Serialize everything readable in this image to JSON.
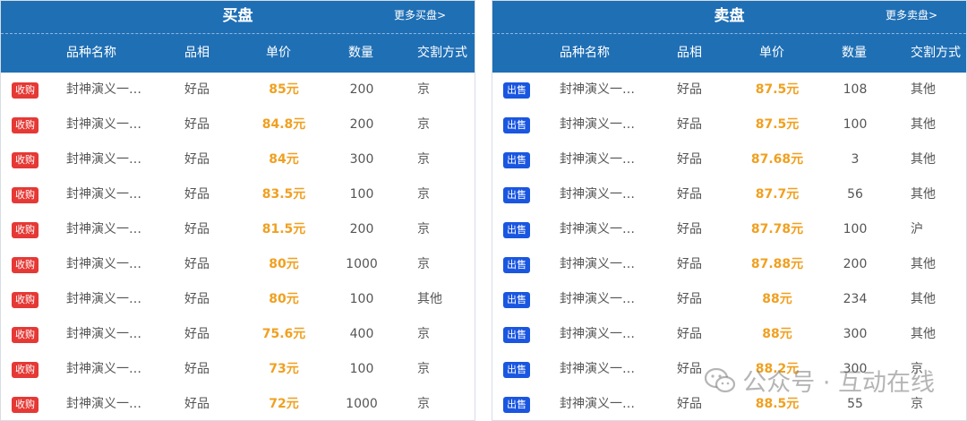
{
  "buy": {
    "title": "买盘",
    "more_label": "更多买盘>",
    "columns": [
      "品种名称",
      "品相",
      "单价",
      "数量",
      "交割方式"
    ],
    "badge_label": "收购",
    "rows": [
      {
        "name": "封神演义一…",
        "grade": "好品",
        "price": "85元",
        "qty": "200",
        "delivery": "京"
      },
      {
        "name": "封神演义一…",
        "grade": "好品",
        "price": "84.8元",
        "qty": "200",
        "delivery": "京"
      },
      {
        "name": "封神演义一…",
        "grade": "好品",
        "price": "84元",
        "qty": "300",
        "delivery": "京"
      },
      {
        "name": "封神演义一…",
        "grade": "好品",
        "price": "83.5元",
        "qty": "100",
        "delivery": "京"
      },
      {
        "name": "封神演义一…",
        "grade": "好品",
        "price": "81.5元",
        "qty": "200",
        "delivery": "京"
      },
      {
        "name": "封神演义一…",
        "grade": "好品",
        "price": "80元",
        "qty": "1000",
        "delivery": "京"
      },
      {
        "name": "封神演义一…",
        "grade": "好品",
        "price": "80元",
        "qty": "100",
        "delivery": "其他"
      },
      {
        "name": "封神演义一…",
        "grade": "好品",
        "price": "75.6元",
        "qty": "400",
        "delivery": "京"
      },
      {
        "name": "封神演义一…",
        "grade": "好品",
        "price": "73元",
        "qty": "100",
        "delivery": "京"
      },
      {
        "name": "封神演义一…",
        "grade": "好品",
        "price": "72元",
        "qty": "1000",
        "delivery": "京"
      }
    ]
  },
  "sell": {
    "title": "卖盘",
    "more_label": "更多卖盘>",
    "columns": [
      "品种名称",
      "品相",
      "单价",
      "数量",
      "交割方式"
    ],
    "badge_label": "出售",
    "rows": [
      {
        "name": "封神演义一…",
        "grade": "好品",
        "price": "87.5元",
        "qty": "108",
        "delivery": "其他"
      },
      {
        "name": "封神演义一…",
        "grade": "好品",
        "price": "87.5元",
        "qty": "100",
        "delivery": "其他"
      },
      {
        "name": "封神演义一…",
        "grade": "好品",
        "price": "87.68元",
        "qty": "3",
        "delivery": "其他"
      },
      {
        "name": "封神演义一…",
        "grade": "好品",
        "price": "87.7元",
        "qty": "56",
        "delivery": "其他"
      },
      {
        "name": "封神演义一…",
        "grade": "好品",
        "price": "87.78元",
        "qty": "100",
        "delivery": "沪"
      },
      {
        "name": "封神演义一…",
        "grade": "好品",
        "price": "87.88元",
        "qty": "200",
        "delivery": "其他"
      },
      {
        "name": "封神演义一…",
        "grade": "好品",
        "price": "88元",
        "qty": "234",
        "delivery": "其他"
      },
      {
        "name": "封神演义一…",
        "grade": "好品",
        "price": "88元",
        "qty": "300",
        "delivery": "其他"
      },
      {
        "name": "封神演义一…",
        "grade": "好品",
        "price": "88.2元",
        "qty": "300",
        "delivery": "京"
      },
      {
        "name": "封神演义一…",
        "grade": "好品",
        "price": "88.5元",
        "qty": "55",
        "delivery": "京"
      }
    ]
  },
  "watermark": {
    "text": "公众号 · 互动在线",
    "icon": "wechat-icon"
  },
  "colors": {
    "header_bg": "#1f6fb5",
    "buy_badge": "#e53935",
    "sell_badge": "#1a56e0",
    "price": "#f0a020"
  }
}
